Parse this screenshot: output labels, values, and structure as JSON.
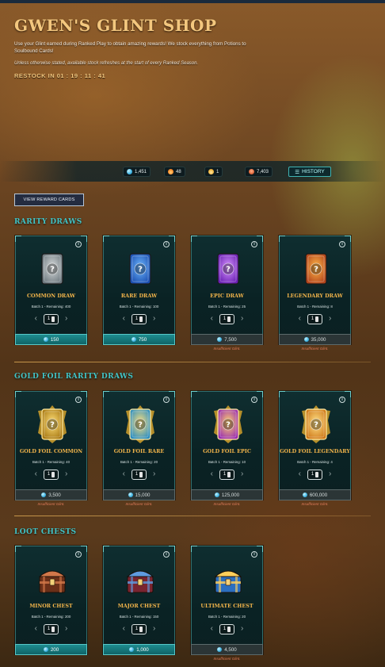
{
  "header": {
    "title": "GWEN'S GLINT SHOP",
    "description": "Use your Glint earned during Ranked Play to obtain amazing rewards! We stock everything from Potions to Soulbound Cards!",
    "note": "Unless otherwise stated, available stock refreshes at the start of every Ranked Season.",
    "restock_label": "RESTOCK IN",
    "restock_time": "01 : 19 : 11 : 41"
  },
  "currencies": [
    {
      "icon": "glint-icon",
      "value": "1,451",
      "color": "#4fc3e6"
    },
    {
      "icon": "flame-potion-icon",
      "value": "48",
      "color": "#ff8c2a"
    },
    {
      "icon": "legendary-potion-icon",
      "value": "1",
      "color": "#f0b43c"
    },
    {
      "icon": "merit-icon",
      "value": "7,403",
      "color": "#e0673a"
    }
  ],
  "history_label": "HISTORY",
  "view_reward_cards_label": "VIEW REWARD CARDS",
  "qty_value": "1",
  "insufficient_label": "Insufficient Glint.",
  "sections": [
    {
      "title": "RARITY DRAWS",
      "items": [
        {
          "name": "COMMON DRAW",
          "batch": "Batch 1 - Remaining: 400",
          "price": "150",
          "affordable": true,
          "art": "common-card-icon",
          "c1": "#d8dcdc",
          "c2": "#6f7a80"
        },
        {
          "name": "RARE DRAW",
          "batch": "Batch 1 - Remaining: 100",
          "price": "750",
          "affordable": true,
          "art": "rare-card-icon",
          "c1": "#6fb8ff",
          "c2": "#1b4fb0"
        },
        {
          "name": "EPIC DRAW",
          "batch": "Batch 1 - Remaining: 25",
          "price": "7,500",
          "affordable": false,
          "art": "epic-card-icon",
          "c1": "#d796ff",
          "c2": "#6a1fb3"
        },
        {
          "name": "LEGENDARY DRAW",
          "batch": "Batch 1 - Remaining: 8",
          "price": "35,000",
          "affordable": false,
          "art": "legendary-card-icon",
          "c1": "#ffb84a",
          "c2": "#b3451b"
        }
      ]
    },
    {
      "title": "GOLD FOIL RARITY DRAWS",
      "items": [
        {
          "name": "GOLD FOIL COMMON",
          "batch": "Batch 1 - Remaining: 40",
          "price": "3,500",
          "affordable": false,
          "art": "gold-foil-common-icon",
          "c1": "#ffe07a",
          "c2": "#a97a14"
        },
        {
          "name": "GOLD FOIL RARE",
          "batch": "Batch 1 - Remaining: 20",
          "price": "15,000",
          "affordable": false,
          "art": "gold-foil-rare-icon",
          "c1": "#ffe07a",
          "c2": "#2f8fc0"
        },
        {
          "name": "GOLD FOIL EPIC",
          "batch": "Batch 1 - Remaining: 10",
          "price": "125,000",
          "affordable": false,
          "art": "gold-foil-epic-icon",
          "c1": "#ffd56a",
          "c2": "#9b2fb0"
        },
        {
          "name": "GOLD FOIL LEGENDARY",
          "batch": "Batch 1 - Remaining: 4",
          "price": "600,000",
          "affordable": false,
          "art": "gold-foil-legendary-icon",
          "c1": "#ffe38a",
          "c2": "#d07a1a"
        }
      ]
    },
    {
      "title": "LOOT CHESTS",
      "items": [
        {
          "name": "MINOR CHEST",
          "batch": "Batch 1 - Remaining: 200",
          "price": "200",
          "affordable": true,
          "art": "minor-chest-icon",
          "c1": "#d2784a",
          "c2": "#6b2f18"
        },
        {
          "name": "MAJOR CHEST",
          "batch": "Batch 1 - Remaining: 150",
          "price": "1,000",
          "affordable": true,
          "art": "major-chest-icon",
          "c1": "#5e9be0",
          "c2": "#7a2430"
        },
        {
          "name": "ULTIMATE CHEST",
          "batch": "Batch 1 - Remaining: 20",
          "price": "4,500",
          "affordable": false,
          "art": "ultimate-chest-icon",
          "c1": "#ffcf5a",
          "c2": "#2b6fc0"
        }
      ]
    }
  ]
}
